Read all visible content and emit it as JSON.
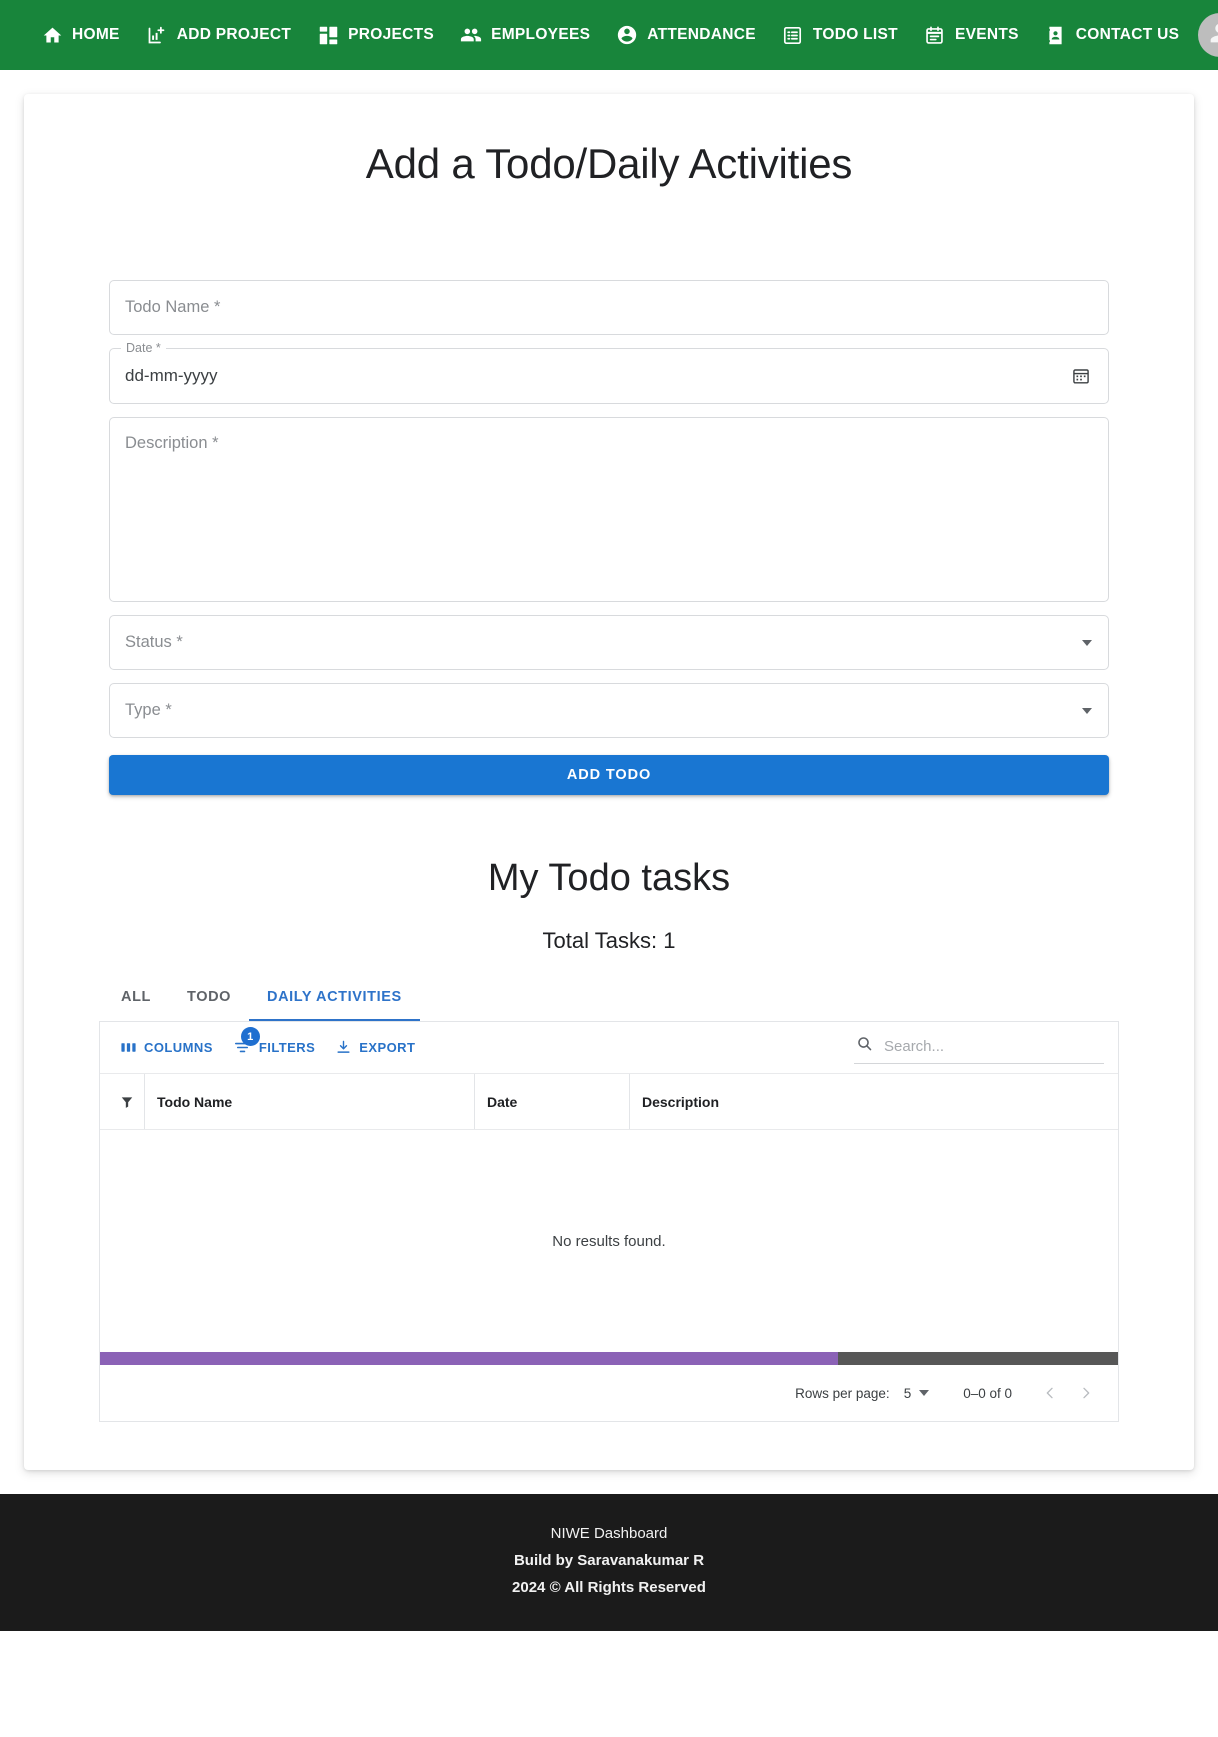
{
  "navbar": {
    "brand_color": "#18853b",
    "items": [
      {
        "label": "HOME",
        "icon": "home-icon"
      },
      {
        "label": "ADD PROJECT",
        "icon": "add-chart-icon"
      },
      {
        "label": "PROJECTS",
        "icon": "dashboard-icon"
      },
      {
        "label": "EMPLOYEES",
        "icon": "people-icon"
      },
      {
        "label": "ATTENDANCE",
        "icon": "account-circle-icon"
      },
      {
        "label": "TODO LIST",
        "icon": "list-alt-icon"
      },
      {
        "label": "EVENTS",
        "icon": "event-icon"
      },
      {
        "label": "CONTACT US",
        "icon": "contact-page-icon"
      }
    ],
    "avatar": "user-avatar-icon"
  },
  "page": {
    "title": "Add a Todo/Daily Activities"
  },
  "form": {
    "todo_name": {
      "label": "Todo Name *",
      "value": ""
    },
    "date": {
      "legend": "Date *",
      "value": "dd-mm-yyyy",
      "icon": "calendar-icon"
    },
    "description": {
      "label": "Description *",
      "value": ""
    },
    "status": {
      "label": "Status *",
      "value": ""
    },
    "type": {
      "label": "Type *",
      "value": ""
    },
    "submit_label": "ADD TODO",
    "submit_color": "#1976d2"
  },
  "tasks": {
    "title": "My Todo tasks",
    "total": "Total Tasks: 1",
    "tabs": [
      {
        "label": "ALL",
        "active": false
      },
      {
        "label": "TODO",
        "active": false
      },
      {
        "label": "DAILY ACTIVITIES",
        "active": true
      }
    ],
    "active_color": "#2e73c9"
  },
  "grid": {
    "toolbar": {
      "columns_label": "COLUMNS",
      "filters_label": "FILTERS",
      "filters_badge": "1",
      "export_label": "EXPORT"
    },
    "search": {
      "placeholder": "Search...",
      "value": ""
    },
    "columns": [
      "Todo Name",
      "Date",
      "Description"
    ],
    "rows": [],
    "empty_message": "No results found.",
    "scrollbar": {
      "thumb_color": "#8b62b6",
      "track_color": "#575757",
      "thumb_percent": 72.5
    },
    "footer": {
      "rows_per_page_label": "Rows per page:",
      "rows_per_page_value": "5",
      "range_label": "0–0 of 0",
      "prev_icon": "chevron-left-icon",
      "next_icon": "chevron-right-icon"
    }
  },
  "footer": {
    "line1": "NIWE Dashboard",
    "line2": "Build by Saravanakumar R",
    "line3": "2024 © All Rights Reserved"
  }
}
